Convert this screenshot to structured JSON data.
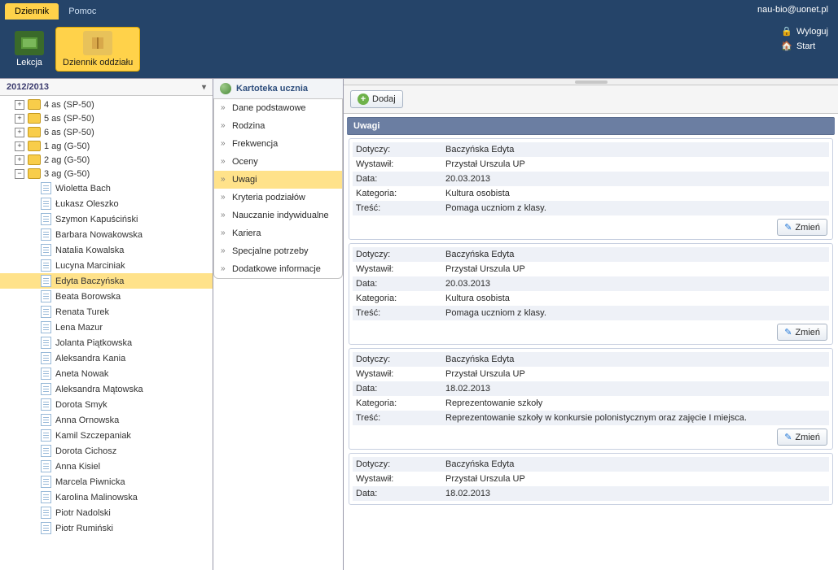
{
  "top": {
    "tabs": [
      {
        "label": "Dziennik",
        "active": true
      },
      {
        "label": "Pomoc",
        "active": false
      }
    ],
    "user": "nau-bio@uonet.pl"
  },
  "ribbon": {
    "buttons": [
      {
        "label": "Lekcja",
        "active": false
      },
      {
        "label": "Dziennik oddziału",
        "active": true
      }
    ],
    "links": {
      "logout": "Wyloguj",
      "start": "Start"
    }
  },
  "sidebar": {
    "year": "2012/2013",
    "nodes": [
      {
        "type": "folder",
        "label": "4 as (SP-50)",
        "expanded": false,
        "level": 1
      },
      {
        "type": "folder",
        "label": "5 as (SP-50)",
        "expanded": false,
        "level": 1
      },
      {
        "type": "folder",
        "label": "6 as (SP-50)",
        "expanded": false,
        "level": 1
      },
      {
        "type": "folder",
        "label": "1 ag (G-50)",
        "expanded": false,
        "level": 1
      },
      {
        "type": "folder",
        "label": "2 ag (G-50)",
        "expanded": false,
        "level": 1
      },
      {
        "type": "folder",
        "label": "3 ag (G-50)",
        "expanded": true,
        "level": 1
      },
      {
        "type": "doc",
        "label": "Wioletta Bach",
        "level": 2
      },
      {
        "type": "doc",
        "label": "Łukasz Oleszko",
        "level": 2
      },
      {
        "type": "doc",
        "label": "Szymon Kapuściński",
        "level": 2
      },
      {
        "type": "doc",
        "label": "Barbara Nowakowska",
        "level": 2
      },
      {
        "type": "doc",
        "label": "Natalia Kowalska",
        "level": 2
      },
      {
        "type": "doc",
        "label": "Lucyna Marciniak",
        "level": 2
      },
      {
        "type": "doc",
        "label": "Edyta Baczyńska",
        "level": 2,
        "selected": true
      },
      {
        "type": "doc",
        "label": "Beata Borowska",
        "level": 2
      },
      {
        "type": "doc",
        "label": "Renata Turek",
        "level": 2
      },
      {
        "type": "doc",
        "label": "Lena Mazur",
        "level": 2
      },
      {
        "type": "doc",
        "label": "Jolanta Piątkowska",
        "level": 2
      },
      {
        "type": "doc",
        "label": "Aleksandra Kania",
        "level": 2
      },
      {
        "type": "doc",
        "label": "Aneta Nowak",
        "level": 2
      },
      {
        "type": "doc",
        "label": "Aleksandra Mątowska",
        "level": 2
      },
      {
        "type": "doc",
        "label": "Dorota Smyk",
        "level": 2
      },
      {
        "type": "doc",
        "label": "Anna Ornowska",
        "level": 2
      },
      {
        "type": "doc",
        "label": "Kamil Szczepaniak",
        "level": 2
      },
      {
        "type": "doc",
        "label": "Dorota Cichosz",
        "level": 2
      },
      {
        "type": "doc",
        "label": "Anna Kisiel",
        "level": 2
      },
      {
        "type": "doc",
        "label": "Marcela Piwnicka",
        "level": 2
      },
      {
        "type": "doc",
        "label": "Karolina Malinowska",
        "level": 2
      },
      {
        "type": "doc",
        "label": "Piotr Nadolski",
        "level": 2
      },
      {
        "type": "doc",
        "label": "Piotr Rumiński",
        "level": 2
      }
    ]
  },
  "subnav": {
    "title": "Kartoteka ucznia",
    "items": [
      {
        "label": "Dane podstawowe"
      },
      {
        "label": "Rodzina"
      },
      {
        "label": "Frekwencja"
      },
      {
        "label": "Oceny"
      },
      {
        "label": "Uwagi",
        "active": true
      },
      {
        "label": "Kryteria podziałów"
      },
      {
        "label": "Nauczanie indywidualne"
      },
      {
        "label": "Kariera"
      },
      {
        "label": "Specjalne potrzeby"
      },
      {
        "label": "Dodatkowe informacje"
      }
    ]
  },
  "content": {
    "add_label": "Dodaj",
    "edit_label": "Zmień",
    "panel_title": "Uwagi",
    "labels": {
      "dotyczy": "Dotyczy:",
      "wystawil": "Wystawił:",
      "data": "Data:",
      "kategoria": "Kategoria:",
      "tresc": "Treść:"
    },
    "records": [
      {
        "dotyczy": "Baczyńska Edyta",
        "wystawil": "Przystał Urszula UP",
        "data": "20.03.2013",
        "kategoria": "Kultura osobista",
        "tresc": "Pomaga uczniom z klasy."
      },
      {
        "dotyczy": "Baczyńska Edyta",
        "wystawil": "Przystał Urszula UP",
        "data": "20.03.2013",
        "kategoria": "Kultura osobista",
        "tresc": "Pomaga uczniom z klasy."
      },
      {
        "dotyczy": "Baczyńska Edyta",
        "wystawil": "Przystał Urszula UP",
        "data": "18.02.2013",
        "kategoria": "Reprezentowanie szkoły",
        "tresc": "Reprezentowanie szkoły w konkursie polonistycznym oraz zajęcie I miejsca."
      },
      {
        "dotyczy": "Baczyńska Edyta",
        "wystawil": "Przystał Urszula UP",
        "data": "18.02.2013"
      }
    ]
  }
}
